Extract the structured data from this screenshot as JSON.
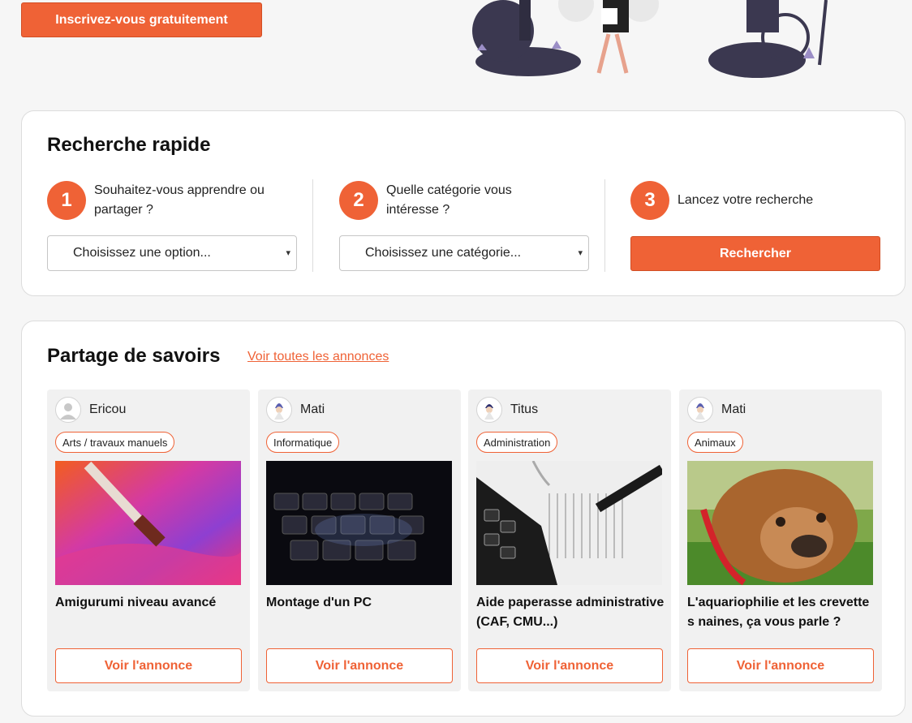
{
  "header": {
    "signup_label": "Inscrivez-vous gratuitement"
  },
  "search": {
    "title": "Recherche rapide",
    "steps": [
      {
        "num": "1",
        "text": "Souhaitez-vous apprendre ou partager ?",
        "select_value": "Choisissez une option..."
      },
      {
        "num": "2",
        "text": "Quelle catégorie vous intéresse ?",
        "select_value": "Choisissez une catégorie..."
      },
      {
        "num": "3",
        "text": "Lancez votre recherche"
      }
    ],
    "button_label": "Rechercher"
  },
  "share": {
    "title": "Partage de savoirs",
    "see_all_label": "Voir toutes les annonces",
    "cards": [
      {
        "user": "Ericou",
        "tag": "Arts / travaux manuels",
        "title": "Amigurumi niveau avancé",
        "button": "Voir l'annonce",
        "image": "paintbrush-art"
      },
      {
        "user": "Mati",
        "tag": "Informatique",
        "title": "Montage d'un PC",
        "button": "Voir l'annonce",
        "image": "keyboard"
      },
      {
        "user": "Titus",
        "tag": "Administration",
        "title": "Aide paperasse administrative (CAF, CMU...)",
        "button": "Voir l'annonce",
        "image": "calculator-pen"
      },
      {
        "user": "Mati",
        "tag": "Animaux",
        "title": "L'aquariophilie et les crevettes naines, ça vous parle ?",
        "button": "Voir l'annonce",
        "image": "bulldog"
      }
    ]
  },
  "colors": {
    "accent": "#ef6236",
    "background": "#f6f6f6",
    "card": "#f1f1f1"
  }
}
